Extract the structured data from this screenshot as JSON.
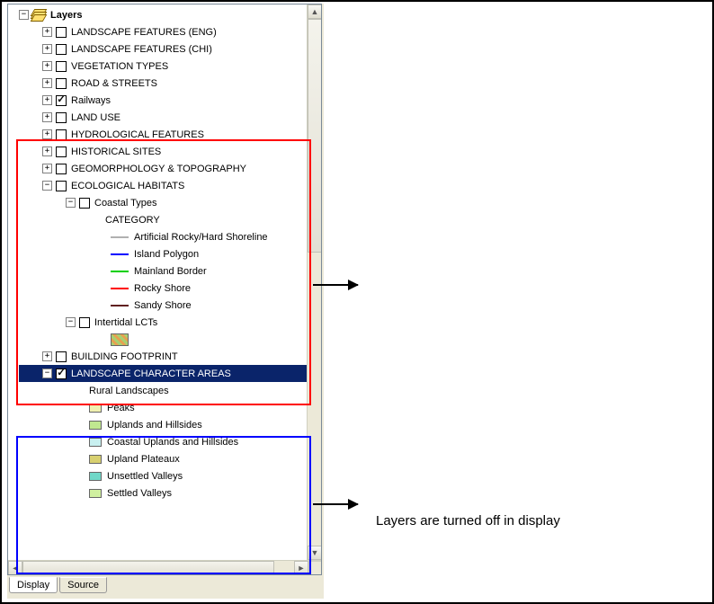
{
  "root": {
    "label": "Layers"
  },
  "groups": [
    {
      "label": "LANDSCAPE FEATURES (ENG)",
      "checked": false
    },
    {
      "label": "LANDSCAPE FEATURES (CHI)",
      "checked": false
    },
    {
      "label": "VEGETATION TYPES",
      "checked": false
    },
    {
      "label": "ROAD & STREETS",
      "checked": false
    },
    {
      "label": "Railways",
      "checked": true
    },
    {
      "label": "LAND USE",
      "checked": false
    },
    {
      "label": "HYDROLOGICAL FEATURES",
      "checked": false
    },
    {
      "label": "HISTORICAL SITES",
      "checked": false
    },
    {
      "label": "GEOMORPHOLOGY & TOPOGRAPHY",
      "checked": false
    }
  ],
  "eco": {
    "label": "ECOLOGICAL HABITATS",
    "checked": false,
    "coastal": {
      "label": "Coastal Types",
      "checked": false,
      "heading": "CATEGORY",
      "items": [
        {
          "label": "Artificial Rocky/Hard Shoreline",
          "color": "#b0b0b0"
        },
        {
          "label": "Island Polygon",
          "color": "#0000ff"
        },
        {
          "label": "Mainland Border",
          "color": "#00d000"
        },
        {
          "label": "Rocky Shore",
          "color": "#ff0000"
        },
        {
          "label": "Sandy Shore",
          "color": "#602020"
        }
      ]
    },
    "intertidal": {
      "label": "Intertidal LCTs",
      "checked": false
    }
  },
  "bf": {
    "label": "BUILDING FOOTPRINT",
    "checked": false
  },
  "lca": {
    "label": "LANDSCAPE CHARACTER AREAS",
    "checked": true,
    "heading": "Rural Landscapes",
    "items": [
      {
        "label": "Peaks",
        "color": "#f0f0b0"
      },
      {
        "label": "Uplands and Hillsides",
        "color": "#c0e890"
      },
      {
        "label": "Coastal Uplands and Hillsides",
        "color": "#c8f0f0"
      },
      {
        "label": "Upland Plateaux",
        "color": "#d8d070"
      },
      {
        "label": "Unsettled Valleys",
        "color": "#70d8c8"
      },
      {
        "label": "Settled Valleys",
        "color": "#d0f0a0"
      }
    ]
  },
  "tabs": {
    "display": "Display",
    "source": "Source"
  },
  "annotation": "Layers are turned off in display"
}
